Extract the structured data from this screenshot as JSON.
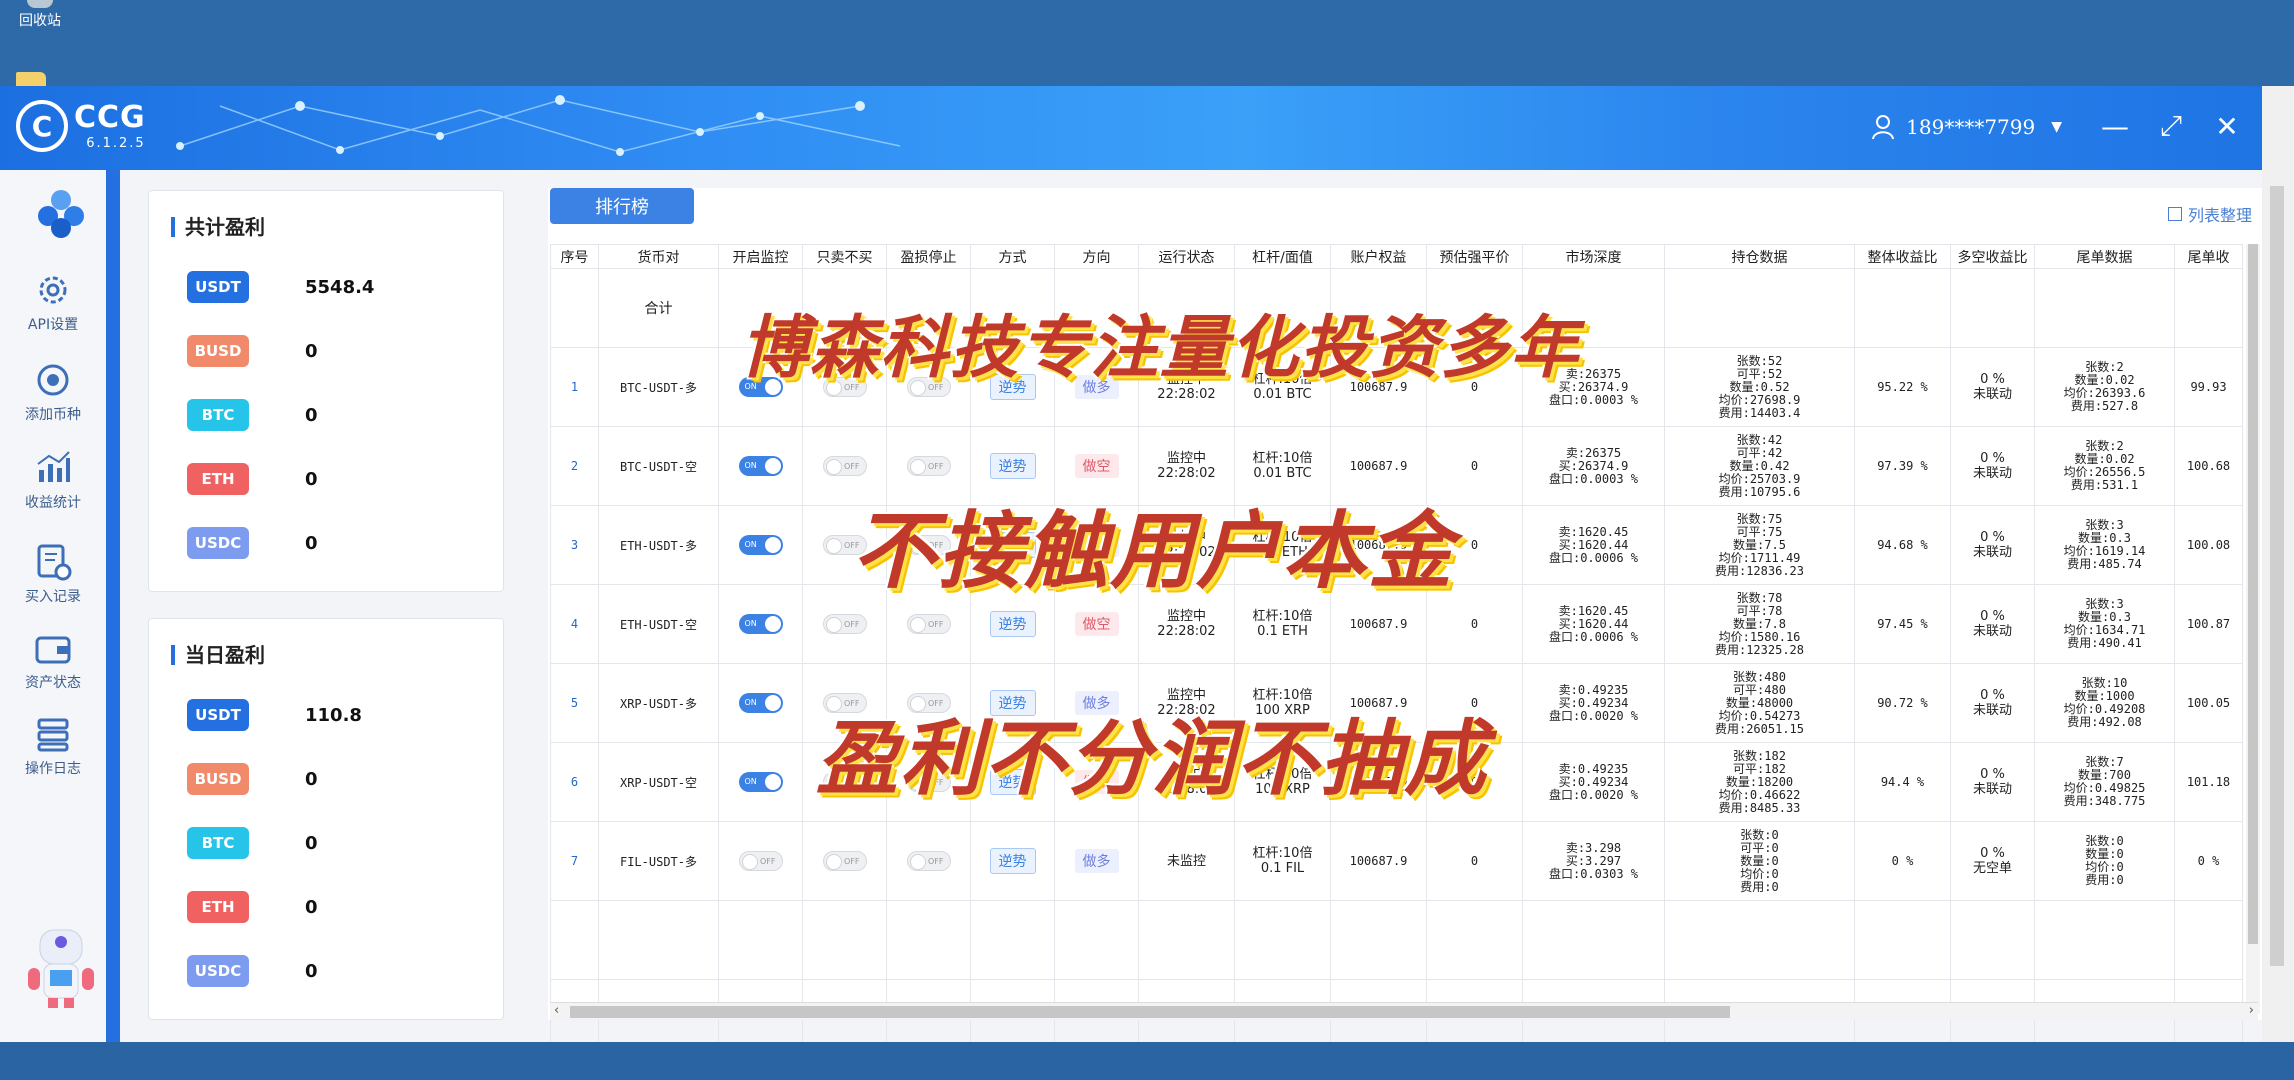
{
  "desktop": {
    "recycle_bin": "回收站"
  },
  "app": {
    "logo_letter": "C",
    "logo_name": "CCG",
    "version": "6.1.2.5",
    "user": "189****7799",
    "controls": {
      "minimize": "—",
      "maximize": "⤢",
      "close": "✕"
    }
  },
  "nav": {
    "items": [
      {
        "label": "API设置"
      },
      {
        "label": "添加币种"
      },
      {
        "label": "收益统计"
      },
      {
        "label": "买入记录"
      },
      {
        "label": "资产状态"
      },
      {
        "label": "操作日志"
      }
    ]
  },
  "total_profit": {
    "title": "共计盈利",
    "rows": [
      {
        "coin": "USDT",
        "value": "5548.4",
        "color": "#2470e0"
      },
      {
        "coin": "BUSD",
        "value": "0",
        "color": "#f08a6a"
      },
      {
        "coin": "BTC",
        "value": "0",
        "color": "#26c4e8"
      },
      {
        "coin": "ETH",
        "value": "0",
        "color": "#f06262"
      },
      {
        "coin": "USDC",
        "value": "0",
        "color": "#7d9cf0"
      }
    ]
  },
  "daily_profit": {
    "title": "当日盈利",
    "rows": [
      {
        "coin": "USDT",
        "value": "110.8",
        "color": "#2470e0"
      },
      {
        "coin": "BUSD",
        "value": "0",
        "color": "#f08a6a"
      },
      {
        "coin": "BTC",
        "value": "0",
        "color": "#26c4e8"
      },
      {
        "coin": "ETH",
        "value": "0",
        "color": "#f06262"
      },
      {
        "coin": "USDC",
        "value": "0",
        "color": "#7d9cf0"
      }
    ]
  },
  "toolbar": {
    "rank": "排行榜",
    "list_org": "列表整理"
  },
  "table": {
    "headers": [
      "序号",
      "货币对",
      "开启监控",
      "只卖不买",
      "盈损停止",
      "方式",
      "方向",
      "运行状态",
      "杠杆/面值",
      "账户权益",
      "预估强平价",
      "市场深度",
      "持仓数据",
      "整体收益比",
      "多空收益比",
      "尾单数据",
      "尾单收"
    ],
    "total_label": "合计",
    "rows": [
      {
        "seq": "1",
        "pair": "BTC-USDT-多",
        "monitor": "ON",
        "sell_only": "OFF",
        "stop": "OFF",
        "mode": "逆势",
        "dir": "做多",
        "dir_style": "lav",
        "status": [
          "监控中",
          "22:28:02"
        ],
        "lev": [
          "杠杆:10倍",
          "0.01 BTC"
        ],
        "equity": "100687.9",
        "liq": "0",
        "depth": [
          "卖:26375",
          "买:26374.9",
          "盘口:0.0003 %"
        ],
        "pos": [
          "张数:52",
          "可平:52",
          "数量:0.52",
          "均价:27698.9",
          "费用:14403.4"
        ],
        "ratio": "95.22 %",
        "ls": [
          "0 %",
          "未联动"
        ],
        "tail": [
          "张数:2",
          "数量:0.02",
          "均价:26393.6",
          "费用:527.8"
        ],
        "tail2": "99.93"
      },
      {
        "seq": "2",
        "pair": "BTC-USDT-空",
        "monitor": "ON",
        "sell_only": "OFF",
        "stop": "OFF",
        "mode": "逆势",
        "dir": "做空",
        "dir_style": "pink",
        "status": [
          "监控中",
          "22:28:02"
        ],
        "lev": [
          "杠杆:10倍",
          "0.01 BTC"
        ],
        "equity": "100687.9",
        "liq": "0",
        "depth": [
          "卖:26375",
          "买:26374.9",
          "盘口:0.0003 %"
        ],
        "pos": [
          "张数:42",
          "可平:42",
          "数量:0.42",
          "均价:25703.9",
          "费用:10795.6"
        ],
        "ratio": "97.39 %",
        "ls": [
          "0 %",
          "未联动"
        ],
        "tail": [
          "张数:2",
          "数量:0.02",
          "均价:26556.5",
          "费用:531.1"
        ],
        "tail2": "100.68"
      },
      {
        "seq": "3",
        "pair": "ETH-USDT-多",
        "monitor": "ON",
        "sell_only": "OFF",
        "stop": "OFF",
        "mode": "逆势",
        "dir": "做多",
        "dir_style": "lav",
        "status": [
          "监控中",
          "22:28:02"
        ],
        "lev": [
          "杠杆:10倍",
          "0.1 ETH"
        ],
        "equity": "100687.9",
        "liq": "0",
        "depth": [
          "卖:1620.45",
          "买:1620.44",
          "盘口:0.0006 %"
        ],
        "pos": [
          "张数:75",
          "可平:75",
          "数量:7.5",
          "均价:1711.49",
          "费用:12836.23"
        ],
        "ratio": "94.68 %",
        "ls": [
          "0 %",
          "未联动"
        ],
        "tail": [
          "张数:3",
          "数量:0.3",
          "均价:1619.14",
          "费用:485.74"
        ],
        "tail2": "100.08"
      },
      {
        "seq": "4",
        "pair": "ETH-USDT-空",
        "monitor": "ON",
        "sell_only": "OFF",
        "stop": "OFF",
        "mode": "逆势",
        "dir": "做空",
        "dir_style": "pink",
        "status": [
          "监控中",
          "22:28:02"
        ],
        "lev": [
          "杠杆:10倍",
          "0.1 ETH"
        ],
        "equity": "100687.9",
        "liq": "0",
        "depth": [
          "卖:1620.45",
          "买:1620.44",
          "盘口:0.0006 %"
        ],
        "pos": [
          "张数:78",
          "可平:78",
          "数量:7.8",
          "均价:1580.16",
          "费用:12325.28"
        ],
        "ratio": "97.45 %",
        "ls": [
          "0 %",
          "未联动"
        ],
        "tail": [
          "张数:3",
          "数量:0.3",
          "均价:1634.71",
          "费用:490.41"
        ],
        "tail2": "100.87"
      },
      {
        "seq": "5",
        "pair": "XRP-USDT-多",
        "monitor": "ON",
        "sell_only": "OFF",
        "stop": "OFF",
        "mode": "逆势",
        "dir": "做多",
        "dir_style": "lav",
        "status": [
          "监控中",
          "22:28:02"
        ],
        "lev": [
          "杠杆:10倍",
          "100 XRP"
        ],
        "equity": "100687.9",
        "liq": "0",
        "depth": [
          "卖:0.49235",
          "买:0.49234",
          "盘口:0.0020 %"
        ],
        "pos": [
          "张数:480",
          "可平:480",
          "数量:48000",
          "均价:0.54273",
          "费用:26051.15"
        ],
        "ratio": "90.72 %",
        "ls": [
          "0 %",
          "未联动"
        ],
        "tail": [
          "张数:10",
          "数量:1000",
          "均价:0.49208",
          "费用:492.08"
        ],
        "tail2": "100.05"
      },
      {
        "seq": "6",
        "pair": "XRP-USDT-空",
        "monitor": "ON",
        "sell_only": "OFF",
        "stop": "OFF",
        "mode": "逆势",
        "dir": "做空",
        "dir_style": "pink",
        "status": [
          "监控中",
          "22:28:02"
        ],
        "lev": [
          "杠杆:10倍",
          "100 XRP"
        ],
        "equity": "100687.9",
        "liq": "0",
        "depth": [
          "卖:0.49235",
          "买:0.49234",
          "盘口:0.0020 %"
        ],
        "pos": [
          "张数:182",
          "可平:182",
          "数量:18200",
          "均价:0.46622",
          "费用:8485.33"
        ],
        "ratio": "94.4 %",
        "ls": [
          "0 %",
          "未联动"
        ],
        "tail": [
          "张数:7",
          "数量:700",
          "均价:0.49825",
          "费用:348.775"
        ],
        "tail2": "101.18"
      },
      {
        "seq": "7",
        "pair": "FIL-USDT-多",
        "monitor": "OFF",
        "sell_only": "OFF",
        "stop": "OFF",
        "mode": "逆势",
        "dir": "做多",
        "dir_style": "lav",
        "status": [
          "未监控"
        ],
        "lev": [
          "杠杆:10倍",
          "0.1 FIL"
        ],
        "equity": "100687.9",
        "liq": "0",
        "depth": [
          "卖:3.298",
          "买:3.297",
          "盘口:0.0303 %"
        ],
        "pos": [
          "张数:0",
          "可平:0",
          "数量:0",
          "均价:0",
          "费用:0"
        ],
        "ratio": "0 %",
        "ls": [
          "0 %",
          "无空单"
        ],
        "tail": [
          "张数:0",
          "数量:0",
          "均价:0",
          "费用:0"
        ],
        "tail2": "0 %"
      }
    ]
  },
  "overlay": {
    "line1": "博森科技专注量化投资多年",
    "line2": "不接触用户本金",
    "line3": "盈利不分润不抽成"
  }
}
